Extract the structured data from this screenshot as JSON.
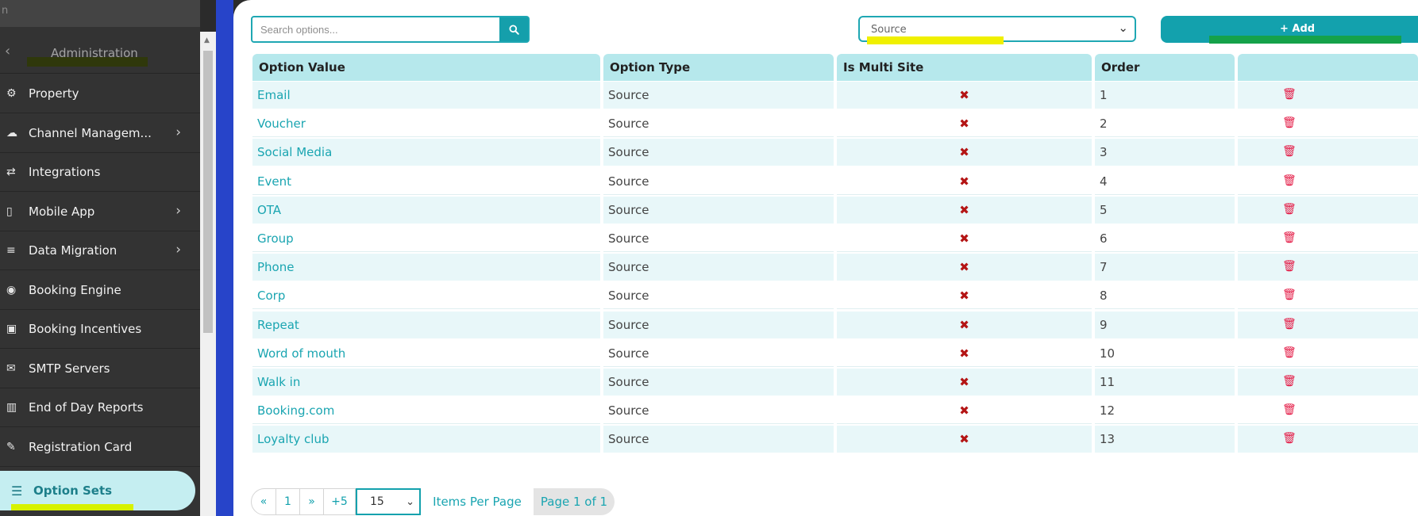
{
  "sidebar": {
    "search_placeholder": "n",
    "header_title": "Administration",
    "items": [
      {
        "label": "Property",
        "icon": "cogs-icon",
        "has_chevron": false
      },
      {
        "label": "Channel Managem...",
        "icon": "cloud-icon",
        "has_chevron": true
      },
      {
        "label": "Integrations",
        "icon": "exchange-icon",
        "has_chevron": false
      },
      {
        "label": "Mobile App",
        "icon": "mobile-icon",
        "has_chevron": true
      },
      {
        "label": "Data Migration",
        "icon": "database-icon",
        "has_chevron": true
      },
      {
        "label": "Booking Engine",
        "icon": "globe-icon",
        "has_chevron": false
      },
      {
        "label": "Booking Incentives",
        "icon": "money-icon",
        "has_chevron": false
      },
      {
        "label": "SMTP Servers",
        "icon": "envelope-icon",
        "has_chevron": false
      },
      {
        "label": "End of Day Reports",
        "icon": "bar-chart-icon",
        "has_chevron": false
      },
      {
        "label": "Registration Card",
        "icon": "edit-icon",
        "has_chevron": false
      }
    ],
    "active_item": {
      "label": "Option Sets",
      "icon": "list-icon"
    }
  },
  "toolbar": {
    "search_placeholder": "Search options...",
    "type_select_value": "Source",
    "add_label": "+ Add"
  },
  "table": {
    "columns": [
      "Option Value",
      "Option Type",
      "Is Multi Site",
      "Order",
      ""
    ],
    "rows": [
      {
        "value": "Email",
        "type": "Source",
        "multi_site": "✖",
        "order": "1"
      },
      {
        "value": "Voucher",
        "type": "Source",
        "multi_site": "✖",
        "order": "2"
      },
      {
        "value": "Social Media",
        "type": "Source",
        "multi_site": "✖",
        "order": "3"
      },
      {
        "value": "Event",
        "type": "Source",
        "multi_site": "✖",
        "order": "4"
      },
      {
        "value": "OTA",
        "type": "Source",
        "multi_site": "✖",
        "order": "5"
      },
      {
        "value": "Group",
        "type": "Source",
        "multi_site": "✖",
        "order": "6"
      },
      {
        "value": "Phone",
        "type": "Source",
        "multi_site": "✖",
        "order": "7"
      },
      {
        "value": "Corp",
        "type": "Source",
        "multi_site": "✖",
        "order": "8"
      },
      {
        "value": "Repeat",
        "type": "Source",
        "multi_site": "✖",
        "order": "9"
      },
      {
        "value": "Word of mouth",
        "type": "Source",
        "multi_site": "✖",
        "order": "10"
      },
      {
        "value": "Walk in",
        "type": "Source",
        "multi_site": "✖",
        "order": "11"
      },
      {
        "value": "Booking.com",
        "type": "Source",
        "multi_site": "✖",
        "order": "12"
      },
      {
        "value": "Loyalty club",
        "type": "Source",
        "multi_site": "✖",
        "order": "13"
      }
    ]
  },
  "pager": {
    "first": "«",
    "page": "1",
    "last": "»",
    "jump": "+5",
    "page_size": "15",
    "items_per_page_label": "Items Per Page",
    "page_of": "Page 1 of 1"
  },
  "colors": {
    "accent": "#13a1ad",
    "header_bg": "#b6e8ec",
    "row_alt": "#e8f7f9",
    "delete": "#e31541",
    "sidebar_bg": "#333333",
    "brand_blue": "#2744c9"
  }
}
